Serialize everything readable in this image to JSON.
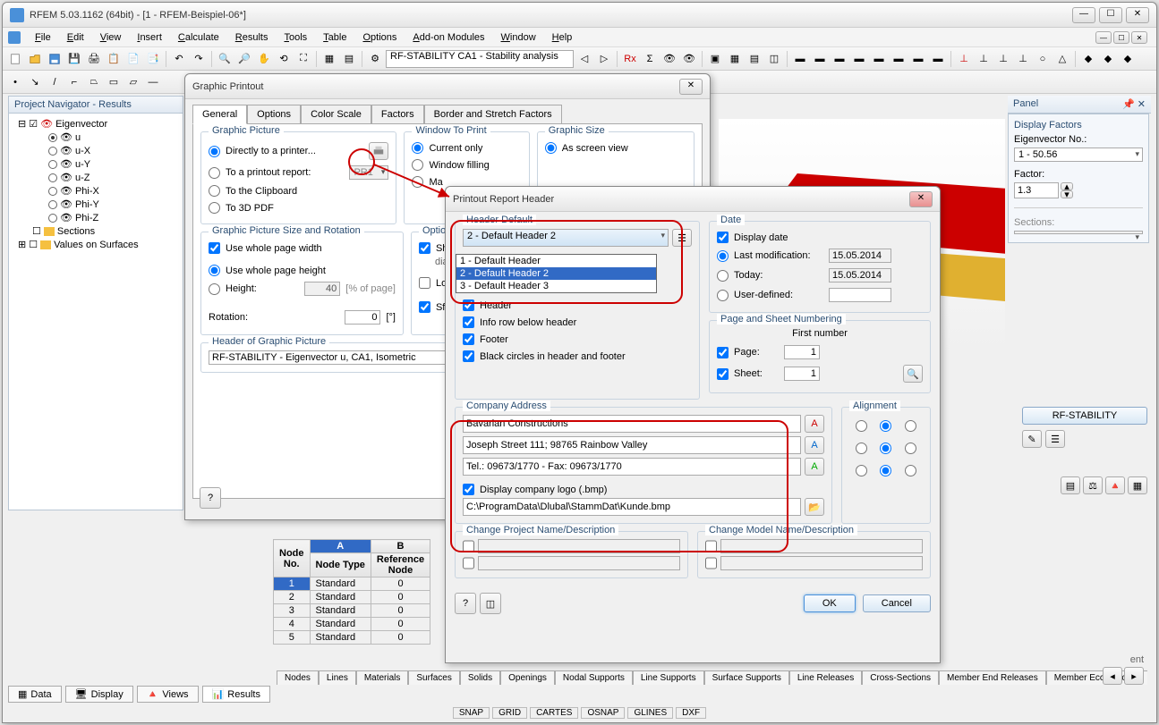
{
  "main": {
    "title": "RFEM 5.03.1162 (64bit) - [1 - RFEM-Beispiel-06*]"
  },
  "menu": [
    "File",
    "Edit",
    "View",
    "Insert",
    "Calculate",
    "Results",
    "Tools",
    "Table",
    "Options",
    "Add-on Modules",
    "Window",
    "Help"
  ],
  "toolbar_combo": "RF-STABILITY CA1 - Stability analysis",
  "navigator": {
    "title": "Project Navigator - Results",
    "root": "Eigenvector",
    "items": [
      "u",
      "u-X",
      "u-Y",
      "u-Z",
      "Phi-X",
      "Phi-Y",
      "Phi-Z"
    ],
    "sections": "Sections",
    "values": "Values on Surfaces"
  },
  "dialog_gp": {
    "title": "Graphic Printout",
    "tabs": [
      "General",
      "Options",
      "Color Scale",
      "Factors",
      "Border and Stretch Factors"
    ],
    "graphic_picture": {
      "title": "Graphic Picture",
      "directly": "Directly to a printer...",
      "to_report": "To a printout report:",
      "report_sel": "PR1",
      "to_clipboard": "To the Clipboard",
      "to_3d_pdf": "To 3D PDF"
    },
    "window_to_print": {
      "title": "Window To Print",
      "current": "Current only",
      "window_filling": "Window filling",
      "mass": "Ma"
    },
    "graphic_size": {
      "title": "Graphic Size",
      "as_screen": "As screen view"
    },
    "size_rotation": {
      "title": "Graphic Picture Size and Rotation",
      "whole_width": "Use whole page width",
      "whole_height": "Use whole page height",
      "height_lbl": "Height:",
      "height_val": "40",
      "height_unit": "[% of page]",
      "rotation_lbl": "Rotation:",
      "rotation_val": "0",
      "rotation_unit": "[°]"
    },
    "options_partial": {
      "title": "Optio",
      "sh": "Sh",
      "dia": "dia",
      "lo": "Lo",
      "sf": "Sf"
    },
    "header_gp": {
      "title": "Header of Graphic Picture",
      "value": "RF-STABILITY - Eigenvector u, CA1, Isometric"
    }
  },
  "dialog_prh": {
    "title": "Printout Report Header",
    "header_default": {
      "title": "Header Default",
      "selected": "2 - Default Header 2",
      "options": [
        "1 - Default Header",
        "2 - Default Header 2",
        "3 - Default Header 3"
      ],
      "header_chk": "Header",
      "info_row": "Info row below header",
      "footer": "Footer",
      "black_circles": "Black circles in header and footer"
    },
    "date": {
      "title": "Date",
      "display": "Display date",
      "last_mod": "Last modification:",
      "last_mod_val": "15.05.2014",
      "today": "Today:",
      "today_val": "15.05.2014",
      "user": "User-defined:"
    },
    "page_sheet": {
      "title": "Page and Sheet Numbering",
      "first_num": "First number",
      "page": "Page:",
      "page_val": "1",
      "sheet": "Sheet:",
      "sheet_val": "1"
    },
    "company": {
      "title": "Company Address",
      "line1": "Bavarian Constructions",
      "line2": "Joseph Street 111; 98765 Rainbow Valley",
      "line3": "Tel.: 09673/1770 - Fax: 09673/1770",
      "display_logo": "Display company logo (.bmp)",
      "logo_path": "C:\\ProgramData\\Dlubal\\StammDat\\Kunde.bmp"
    },
    "alignment": {
      "title": "Alignment"
    },
    "change_proj": "Change Project Name/Description",
    "change_model": "Change Model Name/Description",
    "ok": "OK",
    "cancel": "Cancel"
  },
  "panel": {
    "title": "Panel",
    "display_factors": "Display Factors",
    "eigen_lbl": "Eigenvector No.:",
    "eigen_val": "1 - 50.56",
    "factor_lbl": "Factor:",
    "factor_val": "1.3",
    "sections_lbl": "Sections:",
    "stability_btn": "RF-STABILITY"
  },
  "table": {
    "headers": [
      "Node No.",
      "Node Type",
      "Reference Node"
    ],
    "col_letters": [
      "A",
      "B"
    ],
    "rows": [
      {
        "no": "1",
        "type": "Standard",
        "ref": "0"
      },
      {
        "no": "2",
        "type": "Standard",
        "ref": "0"
      },
      {
        "no": "3",
        "type": "Standard",
        "ref": "0"
      },
      {
        "no": "4",
        "type": "Standard",
        "ref": "0"
      },
      {
        "no": "5",
        "type": "Standard",
        "ref": "0"
      }
    ]
  },
  "bottom_tabs": [
    "Nodes",
    "Lines",
    "Materials",
    "Surfaces",
    "Solids",
    "Openings",
    "Nodal Supports",
    "Line Supports",
    "Surface Supports",
    "Line Releases",
    "Cross-Sections",
    "Member End Releases",
    "Member Eccentricities"
  ],
  "status_tabs": [
    "Data",
    "Display",
    "Views",
    "Results"
  ],
  "statusbar": [
    "SNAP",
    "GRID",
    "CARTES",
    "OSNAP",
    "GLINES",
    "DXF"
  ],
  "right_extra": "ent"
}
